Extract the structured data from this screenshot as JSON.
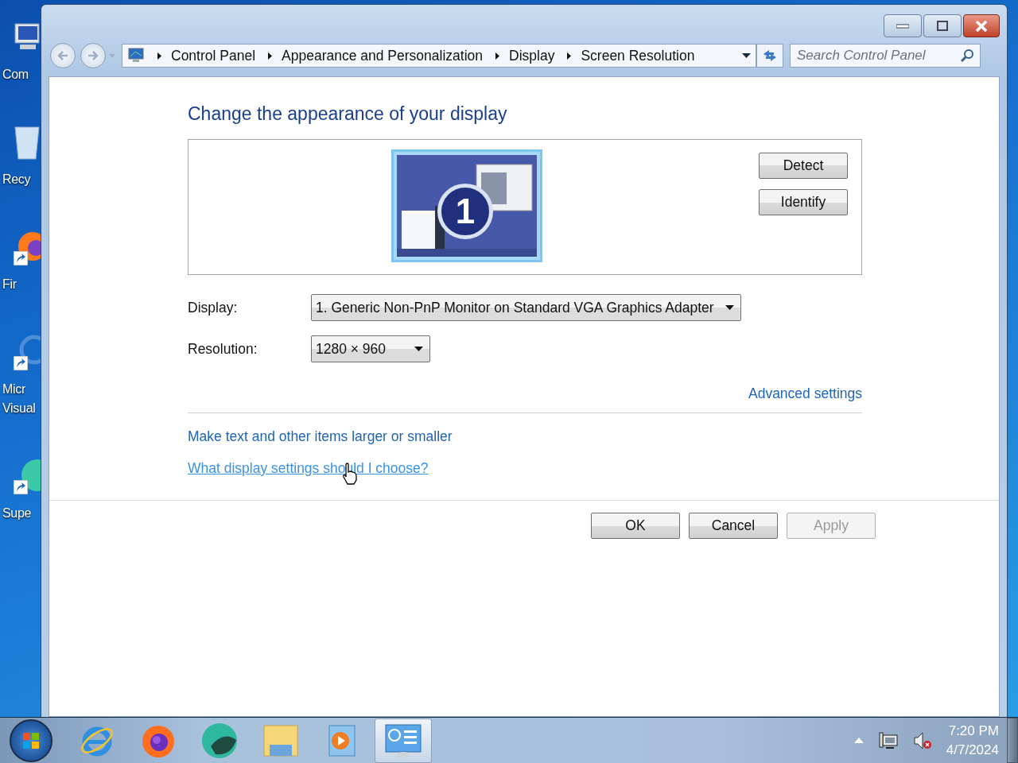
{
  "desktop_icons": [
    {
      "label_lines": [
        "Com"
      ],
      "shortcut": false,
      "kind": "computer"
    },
    {
      "label_lines": [
        "Recy"
      ],
      "shortcut": false,
      "kind": "bin"
    },
    {
      "label_lines": [
        "Fir"
      ],
      "shortcut": true,
      "kind": "firefox"
    },
    {
      "label_lines": [
        "Micr",
        "Visual"
      ],
      "shortcut": true,
      "kind": "vs"
    },
    {
      "label_lines": [
        "Supe"
      ],
      "shortcut": true,
      "kind": "orb"
    }
  ],
  "window": {
    "breadcrumb": [
      "Control Panel",
      "Appearance and Personalization",
      "Display",
      "Screen Resolution"
    ],
    "search": {
      "placeholder": "Search Control Panel"
    }
  },
  "heading": "Change the appearance of your display",
  "monitor_preview": {
    "number": "1"
  },
  "preview_buttons": [
    {
      "label": "Detect"
    },
    {
      "label": "Identify"
    }
  ],
  "fields": [
    {
      "label": "Display:",
      "value": "1. Generic Non-PnP Monitor on Standard VGA Graphics Adapter"
    },
    {
      "label": "Resolution:",
      "value": "1280 × 960"
    }
  ],
  "advanced_link": "Advanced settings",
  "links": [
    {
      "label": "Make text and other items larger or smaller",
      "hovered": false
    },
    {
      "label": "What display settings should I choose?",
      "hovered": true
    }
  ],
  "dialog_buttons": [
    {
      "label": "OK",
      "disabled": false
    },
    {
      "label": "Cancel",
      "disabled": false
    },
    {
      "label": "Apply",
      "disabled": true
    }
  ],
  "taskbar": {
    "apps": [
      {
        "kind": "ie",
        "active": false
      },
      {
        "kind": "firefox",
        "active": false
      },
      {
        "kind": "orb",
        "active": false
      },
      {
        "kind": "explorer",
        "active": false
      },
      {
        "kind": "media",
        "active": false
      },
      {
        "kind": "control-panel",
        "active": true
      }
    ],
    "clock": {
      "time": "7:20 PM",
      "date": "4/7/2024"
    }
  }
}
